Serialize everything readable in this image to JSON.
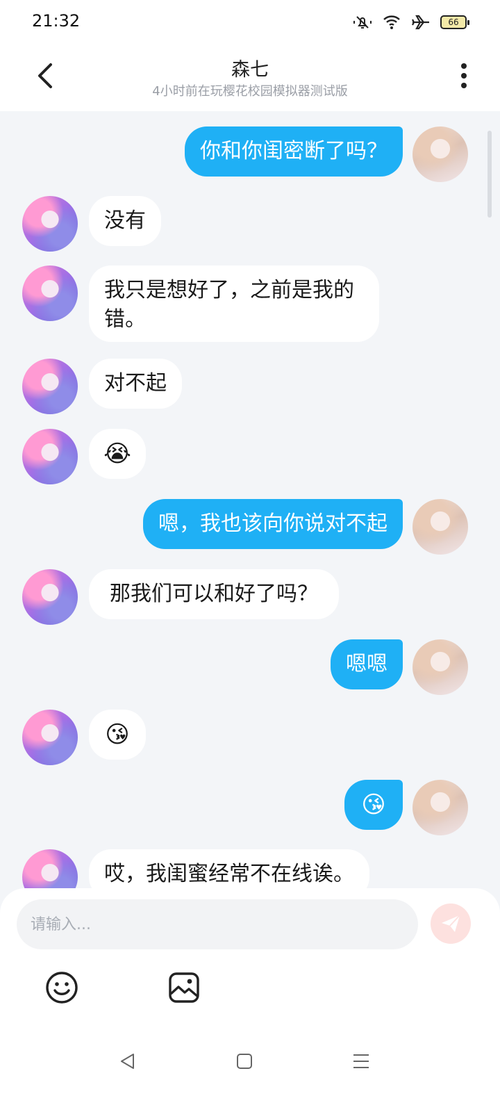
{
  "status_bar": {
    "time": "21:32",
    "battery": "66",
    "icons": [
      "mute-icon",
      "wifi-icon",
      "airplane-icon",
      "battery-icon"
    ]
  },
  "header": {
    "title": "森七",
    "subtitle": "4小时前在玩樱花校园模拟器测试版",
    "back_icon": "chevron-left-icon",
    "more_icon": "more-vertical-icon"
  },
  "messages": [
    {
      "side": "me",
      "text": "你和你闺密断了吗？"
    },
    {
      "side": "them",
      "text": "没有"
    },
    {
      "side": "them",
      "text": "我只是想好了，之前是我的错。"
    },
    {
      "side": "them",
      "text": "对不起"
    },
    {
      "side": "them",
      "text": "😭"
    },
    {
      "side": "me",
      "text": "嗯，我也该向你说对不起"
    },
    {
      "side": "them",
      "text": "那我们可以和好了吗？"
    },
    {
      "side": "me",
      "text": "嗯嗯"
    },
    {
      "side": "them",
      "text": "😘"
    },
    {
      "side": "me",
      "text": "😘"
    },
    {
      "side": "them",
      "text": "哎，我闺蜜经常不在线诶。"
    }
  ],
  "input": {
    "placeholder": "请输入...",
    "value": ""
  },
  "tools": {
    "emoji_icon": "smiley-icon",
    "image_icon": "image-icon",
    "send_icon": "send-icon"
  },
  "colors": {
    "accent": "#1fb0f5",
    "send_button_bg": "#fde1df",
    "send_icon": "#ffffff",
    "page_bg": "#f3f5f8"
  }
}
